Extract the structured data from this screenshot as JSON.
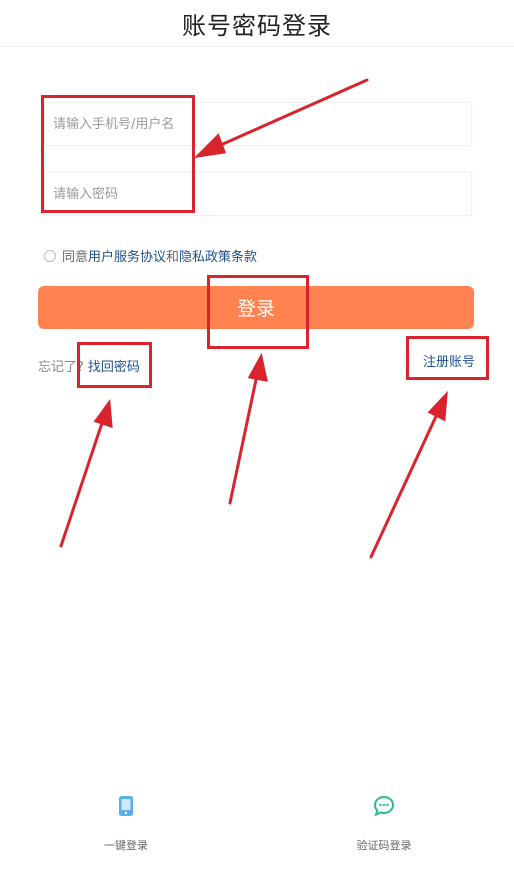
{
  "header": {
    "title": "账号密码登录"
  },
  "form": {
    "username_placeholder": "请输入手机号/用户名",
    "password_placeholder": "请输入密码"
  },
  "agreement": {
    "prefix": "同意",
    "user_agreement": "用户服务协议",
    "and": "和",
    "privacy_policy": "隐私政策条款"
  },
  "login_button": "登录",
  "forgot": {
    "text": "忘记了?",
    "link": "找回密码"
  },
  "register": "注册账号",
  "bottom": {
    "one_click_label": "一键登录",
    "one_click_icon": "phone-icon",
    "sms_label": "验证码登录",
    "sms_icon": "chat-bubble-icon"
  },
  "colors": {
    "accent": "#ff8350",
    "link": "#1e4f8f",
    "annotation": "#d9232d",
    "sms_icon": "#2bbb8a",
    "phone_icon": "#5ab0e6"
  }
}
